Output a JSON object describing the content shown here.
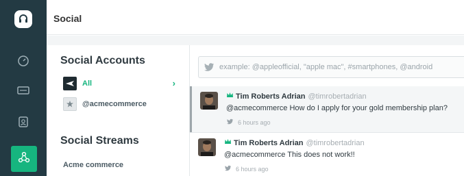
{
  "nav": {
    "items": [
      {
        "name": "logo",
        "icon": "headset-icon"
      },
      {
        "name": "dashboard",
        "icon": "gauge-icon"
      },
      {
        "name": "tickets",
        "icon": "ticket-icon"
      },
      {
        "name": "contacts",
        "icon": "contact-card-icon"
      },
      {
        "name": "social",
        "icon": "social-network-icon",
        "active": true
      }
    ],
    "colors": {
      "rail": "#233a43",
      "active": "#16b57f"
    }
  },
  "header": {
    "title": "Social"
  },
  "social_accounts": {
    "title": "Social Accounts",
    "items": [
      {
        "label": "All",
        "icon": "plane-icon",
        "active": true
      },
      {
        "label": "@acmecommerce",
        "icon": "account-avatar-icon",
        "active": false
      }
    ]
  },
  "social_streams": {
    "title": "Social Streams",
    "items": [
      {
        "label": "Acme commerce"
      }
    ]
  },
  "search": {
    "placeholder": "example: @appleofficial, \"apple mac\", #smartphones, @android",
    "icon": "twitter-bird-icon"
  },
  "posts": [
    {
      "author": "Tim Roberts Adrian",
      "handle": "@timrobertadrian",
      "text": "@acmecommerce How do I apply for your gold membership plan?",
      "time": "6 hours ago",
      "highlighted": true
    },
    {
      "author": "Tim Roberts Adrian",
      "handle": "@timrobertadrian",
      "text": "@acmecommerce This does not work!!",
      "time": "6 hours ago",
      "highlighted": false
    }
  ]
}
